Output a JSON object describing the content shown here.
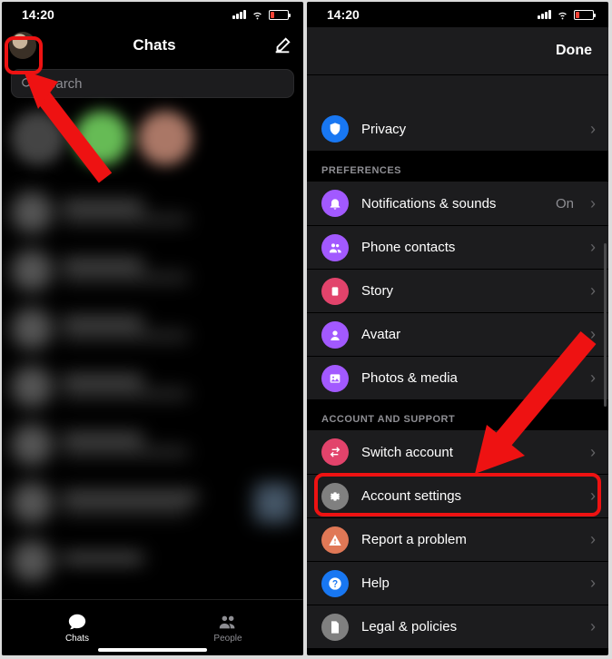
{
  "left": {
    "status_time": "14:20",
    "header_title": "Chats",
    "search_placeholder": "Search",
    "tabs": {
      "chats": "Chats",
      "people": "People"
    }
  },
  "right": {
    "status_time": "14:20",
    "done_label": "Done",
    "privacy": "Privacy",
    "section_preferences": "Preferences",
    "notifications": "Notifications & sounds",
    "notifications_value": "On",
    "phone_contacts": "Phone contacts",
    "story": "Story",
    "avatar": "Avatar",
    "photos_media": "Photos & media",
    "section_account": "Account and Support",
    "switch_account": "Switch account",
    "account_settings": "Account settings",
    "report_problem": "Report a problem",
    "help": "Help",
    "legal": "Legal & policies"
  },
  "colors": {
    "privacy": "#1877f2",
    "notifications": "#a259ff",
    "phone_contacts": "#a259ff",
    "story": "#e2436b",
    "avatar": "#a259ff",
    "photos_media": "#a259ff",
    "switch": "#e2436b",
    "account_settings": "#808080",
    "report": "#e07856",
    "help": "#1877f2",
    "legal": "#808080"
  }
}
